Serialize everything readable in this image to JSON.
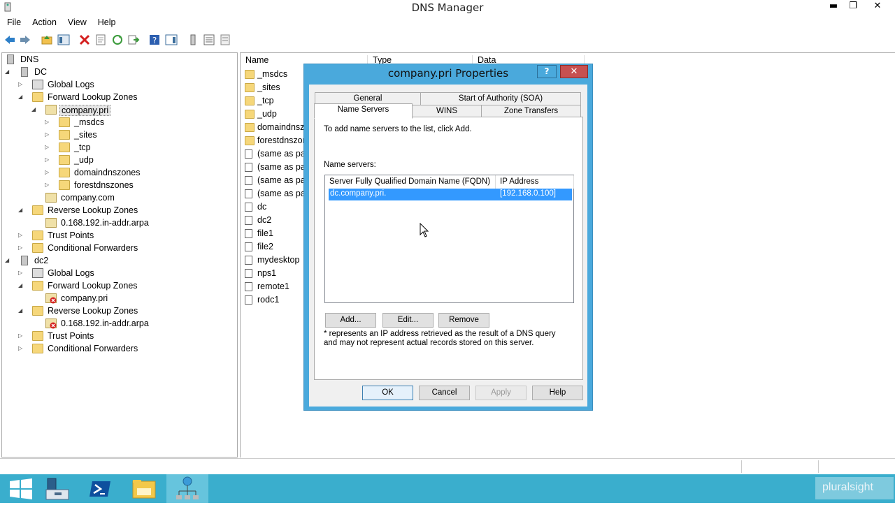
{
  "window": {
    "title": "DNS Manager",
    "min": "▬",
    "max": "❐",
    "close": "✕"
  },
  "menu": [
    "File",
    "Action",
    "View",
    "Help"
  ],
  "tree": [
    {
      "label": "DNS",
      "level": 0,
      "icon": "dns-icon",
      "exp": ""
    },
    {
      "label": "DC",
      "level": 1,
      "icon": "server-icon",
      "exp": "◢"
    },
    {
      "label": "Global Logs",
      "level": 2,
      "icon": "log-icon",
      "exp": "▷"
    },
    {
      "label": "Forward Lookup Zones",
      "level": 2,
      "icon": "folder-icon",
      "exp": "◢"
    },
    {
      "label": "company.pri",
      "level": 3,
      "icon": "zone-icon",
      "exp": "◢",
      "selected": true
    },
    {
      "label": "_msdcs",
      "level": 4,
      "icon": "folder-icon",
      "exp": "▷"
    },
    {
      "label": "_sites",
      "level": 4,
      "icon": "folder-icon",
      "exp": "▷"
    },
    {
      "label": "_tcp",
      "level": 4,
      "icon": "folder-icon",
      "exp": "▷"
    },
    {
      "label": "_udp",
      "level": 4,
      "icon": "folder-icon",
      "exp": "▷"
    },
    {
      "label": "domaindnszones",
      "level": 4,
      "icon": "folder-icon",
      "exp": "▷"
    },
    {
      "label": "forestdnszones",
      "level": 4,
      "icon": "folder-icon",
      "exp": "▷"
    },
    {
      "label": "company.com",
      "level": 3,
      "icon": "zone-icon",
      "exp": ""
    },
    {
      "label": "Reverse Lookup Zones",
      "level": 2,
      "icon": "folder-icon",
      "exp": "◢"
    },
    {
      "label": "0.168.192.in-addr.arpa",
      "level": 3,
      "icon": "zone-icon",
      "exp": ""
    },
    {
      "label": "Trust Points",
      "level": 2,
      "icon": "folder-icon",
      "exp": "▷"
    },
    {
      "label": "Conditional Forwarders",
      "level": 2,
      "icon": "folder-icon",
      "exp": "▷"
    },
    {
      "label": "dc2",
      "level": 1,
      "icon": "server-icon",
      "exp": "◢"
    },
    {
      "label": "Global Logs",
      "level": 2,
      "icon": "log-icon",
      "exp": "▷"
    },
    {
      "label": "Forward Lookup Zones",
      "level": 2,
      "icon": "folder-icon",
      "exp": "◢"
    },
    {
      "label": "company.pri",
      "level": 3,
      "icon": "zone-error-icon",
      "exp": ""
    },
    {
      "label": "Reverse Lookup Zones",
      "level": 2,
      "icon": "folder-icon",
      "exp": "◢"
    },
    {
      "label": "0.168.192.in-addr.arpa",
      "level": 3,
      "icon": "zone-error-icon",
      "exp": ""
    },
    {
      "label": "Trust Points",
      "level": 2,
      "icon": "folder-icon",
      "exp": "▷"
    },
    {
      "label": "Conditional Forwarders",
      "level": 2,
      "icon": "folder-icon",
      "exp": "▷"
    }
  ],
  "list": {
    "columns": [
      "Name",
      "Type",
      "Data"
    ],
    "items": [
      {
        "name": "_msdcs",
        "icon": "folder-icon"
      },
      {
        "name": "_sites",
        "icon": "folder-icon"
      },
      {
        "name": "_tcp",
        "icon": "folder-icon"
      },
      {
        "name": "_udp",
        "icon": "folder-icon"
      },
      {
        "name": "domaindnszo",
        "icon": "folder-icon"
      },
      {
        "name": "forestdnszon",
        "icon": "folder-icon"
      },
      {
        "name": "(same as par",
        "icon": "record-icon"
      },
      {
        "name": "(same as par",
        "icon": "record-icon"
      },
      {
        "name": "(same as par",
        "icon": "record-icon"
      },
      {
        "name": "(same as par",
        "icon": "record-icon"
      },
      {
        "name": "dc",
        "icon": "record-icon"
      },
      {
        "name": "dc2",
        "icon": "record-icon"
      },
      {
        "name": "file1",
        "icon": "record-icon"
      },
      {
        "name": "file2",
        "icon": "record-icon"
      },
      {
        "name": "mydesktop",
        "icon": "record-icon"
      },
      {
        "name": "nps1",
        "icon": "record-icon"
      },
      {
        "name": "remote1",
        "icon": "record-icon"
      },
      {
        "name": "rodc1",
        "icon": "record-icon"
      }
    ]
  },
  "dialog": {
    "title": "company.pri Properties",
    "help": "?",
    "close": "✕",
    "tabs_row1": [
      "General",
      "Start of Authority (SOA)"
    ],
    "tabs_row2": [
      "Name Servers",
      "WINS",
      "Zone Transfers"
    ],
    "intro": "To add name servers to the list, click Add.",
    "ns_label": "Name servers:",
    "ns_columns": [
      "Server Fully Qualified Domain Name (FQDN)",
      "IP Address"
    ],
    "ns_rows": [
      {
        "fqdn": "dc.company.pri.",
        "ip": "[192.168.0.100]"
      }
    ],
    "add": "Add...",
    "edit": "Edit...",
    "remove": "Remove",
    "note": "* represents an IP address retrieved as the result of a DNS query and may not represent actual records stored on this server.",
    "ok": "OK",
    "cancel": "Cancel",
    "apply": "Apply",
    "helpbtn": "Help"
  },
  "watermark": "pluralsight"
}
